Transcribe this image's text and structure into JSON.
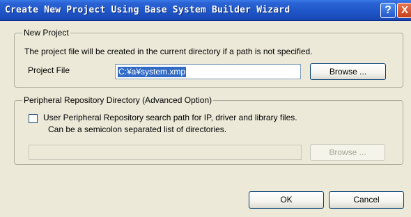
{
  "window": {
    "title": "Create New Project Using Base System Builder Wizard",
    "help_label": "?",
    "close_label": "X"
  },
  "new_project": {
    "legend": "New Project",
    "description": "The project file will be created in the current directory if a path is not specified.",
    "file_label": "Project File",
    "file_value": "C:¥a¥system.xmp",
    "browse_label": "Browse ..."
  },
  "peripheral": {
    "legend": "Peripheral Repository Directory (Advanced Option)",
    "checkbox_checked": false,
    "checkbox_label_line1": "User Peripheral Repository search path for IP, driver and library files.",
    "checkbox_label_line2": "Can be a semicolon separated list of directories.",
    "path_value": "",
    "browse_label": "Browse ..."
  },
  "footer": {
    "ok_label": "OK",
    "cancel_label": "Cancel"
  }
}
